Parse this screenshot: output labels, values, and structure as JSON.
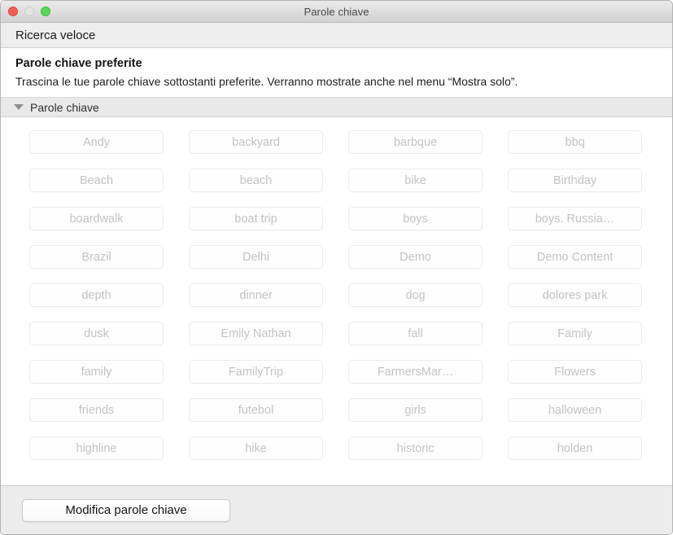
{
  "window": {
    "title": "Parole chiave",
    "controls": {
      "close": "close-button",
      "minimize": "minimize-button",
      "maximize": "maximize-button"
    }
  },
  "search": {
    "value": "",
    "placeholder": "Ricerca veloce"
  },
  "favorites": {
    "title": "Parole chiave preferite",
    "description": "Trascina le tue parole chiave sottostanti preferite. Verranno mostrate anche nel menu “Mostra solo”."
  },
  "section": {
    "label": "Parole chiave",
    "expanded": true,
    "disclosure_icon": "triangle-down-icon"
  },
  "keywords": [
    "Andy",
    "backyard",
    "barbque",
    "bbq",
    "Beach",
    "beach",
    "bike",
    "Birthday",
    "boardwalk",
    "boat trip",
    "boys",
    "boys. Russia…",
    "Brazil",
    "Delhi",
    "Demo",
    "Demo Content",
    "depth",
    "dinner",
    "dog",
    "dolores park",
    "dusk",
    "Emily Nathan",
    "fall",
    "Family",
    "family",
    "FamilyTrip",
    "FarmersMar…",
    "Flowers",
    "friends",
    "futebol",
    "girls",
    "halloween",
    "highline",
    "hike",
    "historic",
    "holden"
  ],
  "footer": {
    "edit_button_label": "Modifica parole chiave"
  },
  "colors": {
    "titlebar_top": "#ebebeb",
    "titlebar_bottom": "#d2d2d2",
    "close_red": "#f25d56",
    "minimize_gray": "#e4e4e4",
    "maximize_green": "#5fd45a",
    "section_header_bg": "#e9e9e9",
    "bottom_bar_bg": "#ececec",
    "pill_border": "#ececec",
    "pill_text": "#c4c4c4"
  }
}
